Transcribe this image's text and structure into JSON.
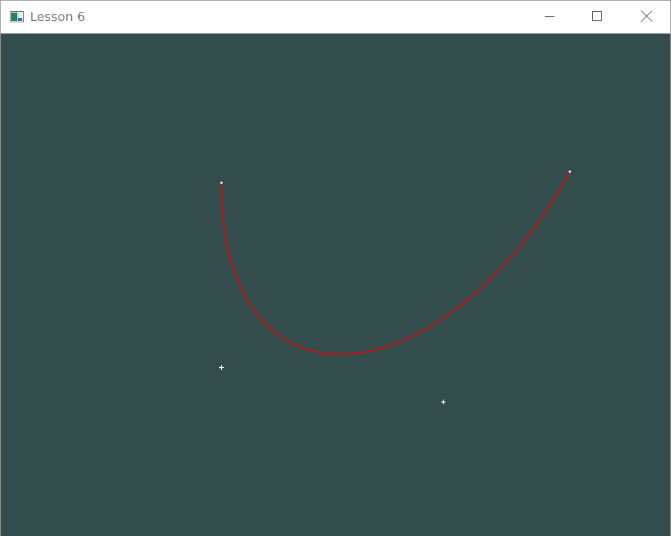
{
  "window": {
    "title": "Lesson 6",
    "icon": "app-window-icon",
    "controls": {
      "minimize_icon": "minimize-icon",
      "maximize_icon": "maximize-icon",
      "close_icon": "close-icon"
    }
  },
  "canvas": {
    "background_color": "#334d4d",
    "curve_color": "#b31a1a",
    "point_color": "#ffffff"
  }
}
